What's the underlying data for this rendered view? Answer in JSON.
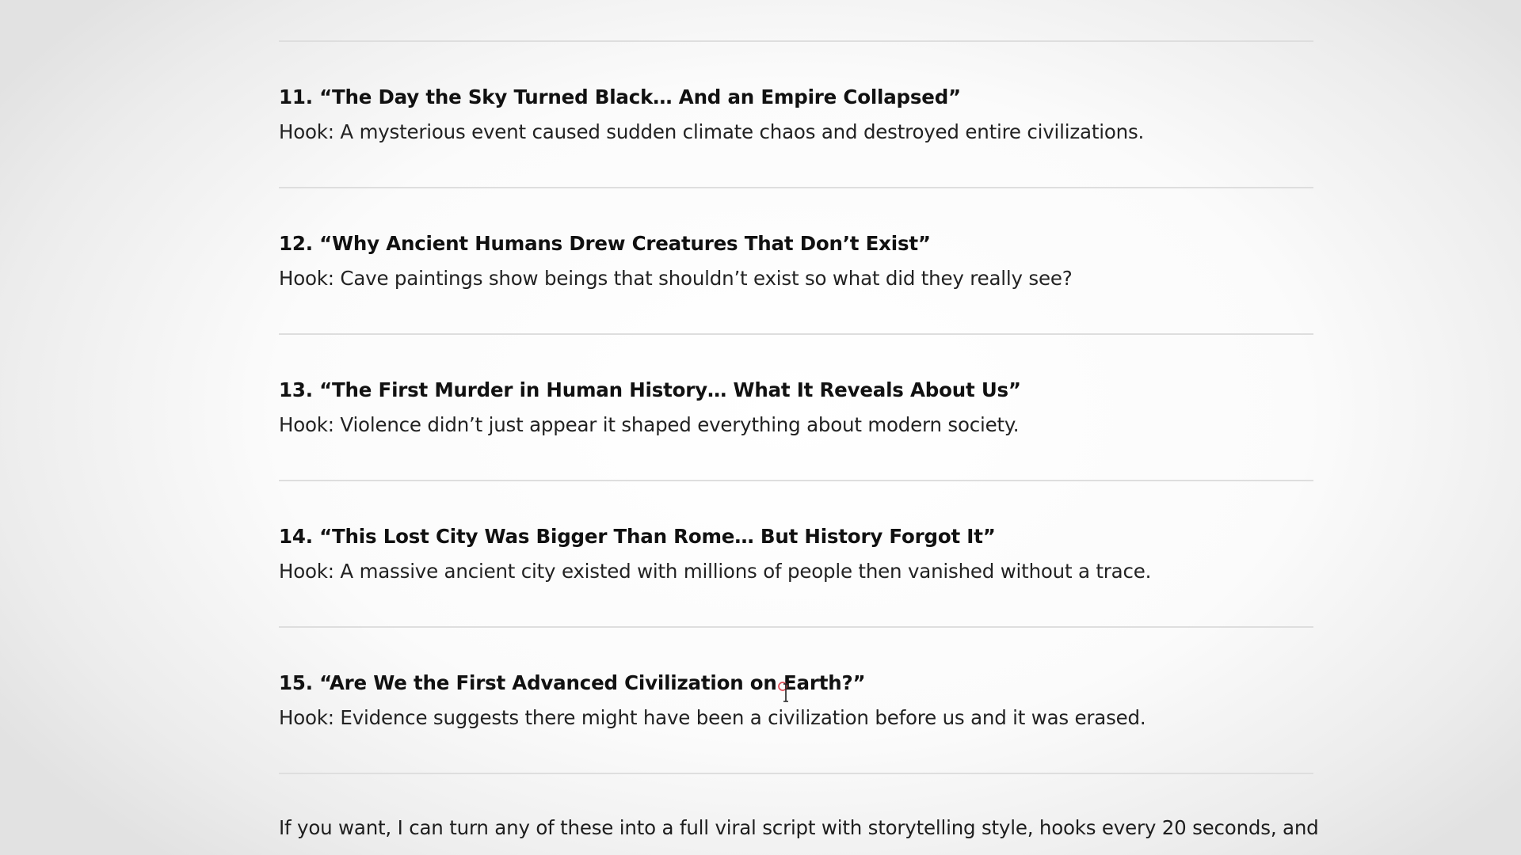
{
  "items": [
    {
      "title": "11. “The Day the Sky Turned Black… And an Empire Collapsed”",
      "hook": "Hook: A mysterious event caused sudden climate chaos and destroyed entire civilizations."
    },
    {
      "title": "12. “Why Ancient Humans Drew Creatures That Don’t Exist”",
      "hook": "Hook: Cave paintings show beings that shouldn’t exist so what did they really see?"
    },
    {
      "title": "13. “The First Murder in Human History… What It Reveals About Us”",
      "hook": "Hook: Violence didn’t just appear it shaped everything about modern society."
    },
    {
      "title": "14. “This Lost City Was Bigger Than Rome… But History Forgot It”",
      "hook": "Hook: A massive ancient city existed with millions of people then vanished without a trace."
    },
    {
      "title": "15. “Are We the First Advanced Civilization on Earth?”",
      "hook": "Hook: Evidence suggests there might have been a civilization before us and it was erased."
    }
  ],
  "closing": "If you want, I can turn any of these into a full viral script with storytelling style, hooks every 20 seconds, and",
  "colors": {
    "text_primary": "#111111",
    "text_body": "#222222",
    "divider": "#dedede",
    "cursor_accent": "#e0505a"
  },
  "icons": {
    "cursor": "text-cursor-icon"
  }
}
